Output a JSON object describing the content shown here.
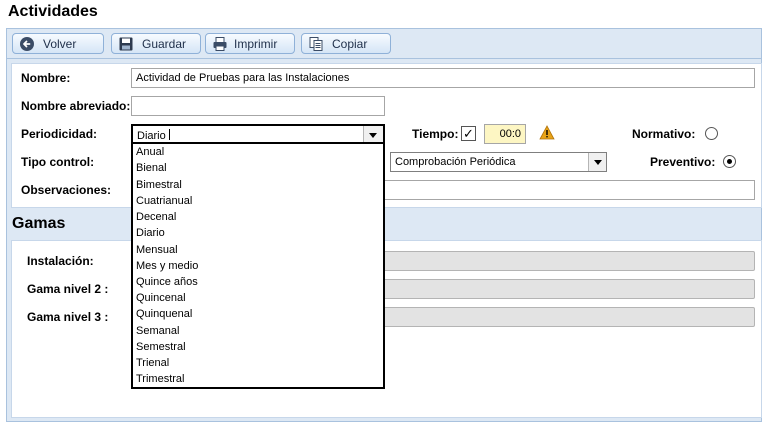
{
  "page": {
    "title": "Actividades"
  },
  "toolbar": {
    "back_label": "Volver",
    "save_label": "Guardar",
    "print_label": "Imprimir",
    "copy_label": "Copiar"
  },
  "form": {
    "nombre_label": "Nombre:",
    "nombre_value": "Actividad de Pruebas para las Instalaciones",
    "nombre_abreviado_label": "Nombre abreviado:",
    "nombre_abreviado_value": "",
    "periodicidad_label": "Periodicidad:",
    "periodicidad_value": "Diario",
    "tiempo_label": "Tiempo:",
    "tiempo_checked": true,
    "tiempo_value": "00:0",
    "normativo_label": "Normativo:",
    "normativo_selected": false,
    "tipo_control_label": "Tipo control:",
    "tipo_control_value": "Comprobación Periódica",
    "preventivo_label": "Preventivo:",
    "preventivo_selected": true,
    "observaciones_label": "Observaciones:",
    "observaciones_value": ""
  },
  "periodicidad_options": [
    "Anual",
    "Bienal",
    "Bimestral",
    "Cuatrianual",
    "Decenal",
    "Diario",
    "Mensual",
    "Mes y medio",
    "Quince años",
    "Quincenal",
    "Quinquenal",
    "Semanal",
    "Semestral",
    "Trienal",
    "Trimestral"
  ],
  "gamas": {
    "title": "Gamas",
    "instalacion_label": "Instalación:",
    "gama2_label": "Gama nivel 2 :",
    "gama3_label": "Gama nivel 3 :"
  },
  "colors": {
    "toolbar_bg": "#dde8f4",
    "warning": "#e8a317",
    "time_field_bg": "#fdf6c3"
  },
  "icons": {
    "back": "back-arrow-icon",
    "save": "floppy-disk-icon",
    "print": "printer-icon",
    "copy": "copy-icon",
    "warning": "warning-triangle-icon"
  }
}
